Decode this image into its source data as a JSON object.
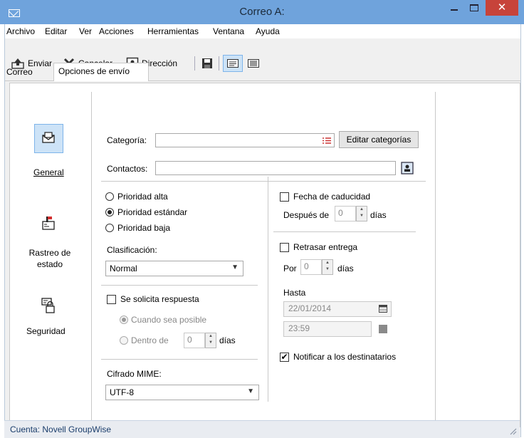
{
  "window": {
    "title": "Correo A:",
    "close_glyph": "✕"
  },
  "menu": [
    "Archivo",
    "Editar",
    "Ver",
    "Acciones",
    "Herramientas",
    "Ventana",
    "Ayuda"
  ],
  "toolbar": {
    "send": "Enviar",
    "cancel": "Cancelar",
    "address": "Dirección"
  },
  "tabs": [
    {
      "label": "Correo"
    },
    {
      "label": "Opciones de envío",
      "active": true
    }
  ],
  "sidebar": [
    {
      "label": "General",
      "active": true
    },
    {
      "label": "Rastreo de estado"
    },
    {
      "label": "Seguridad"
    }
  ],
  "general": {
    "category_label": "Categoría:",
    "category_value": "",
    "edit_categories": "Editar categorías",
    "contacts_label": "Contactos:",
    "contacts_value": "",
    "priority_high": "Prioridad alta",
    "priority_standard": "Prioridad estándar",
    "priority_low": "Prioridad baja",
    "classification_label": "Clasificación:",
    "classification_value": "Normal",
    "reply_requested": "Se solicita respuesta",
    "when_possible": "Cuando sea posible",
    "within": "Dentro de",
    "within_value": "0",
    "days": "días",
    "mime_label": "Cifrado MIME:",
    "mime_value": "UTF-8",
    "expiration": "Fecha de caducidad",
    "after": "Después de",
    "after_value": "0",
    "delay": "Retrasar entrega",
    "by": "Por",
    "by_value": "0",
    "until": "Hasta",
    "until_date": "22/01/2014",
    "until_time": "23:59",
    "notify": "Notificar a los destinatarios",
    "notify_checked": true
  },
  "status": {
    "account": "Cuenta: Novell GroupWise"
  },
  "colors": {
    "titlebar": "#6fa3dc",
    "close": "#c7433a",
    "selected": "#cde3f7"
  }
}
